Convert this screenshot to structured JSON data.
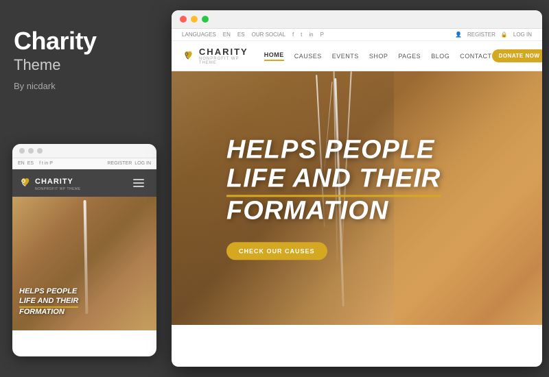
{
  "theme": {
    "title": "Charity",
    "subtitle": "Theme",
    "author": "By nicdark"
  },
  "mobile": {
    "lang_items": [
      "EN",
      "ES"
    ],
    "register": "REGISTER",
    "login": "LOG IN",
    "logo_name": "CHARITY",
    "logo_tagline": "NONPROFIT WP THEME",
    "hero_line1": "HELPS PEOPLE",
    "hero_line2": "LIFE AND THEIR",
    "hero_line3": "FORMATION"
  },
  "desktop": {
    "top_bar": {
      "languages": "LANGUAGES",
      "lang_en": "EN",
      "lang_es": "ES",
      "our_social": "OUR SOCIAL",
      "register": "REGISTER",
      "login": "LOG IN"
    },
    "nav": {
      "logo_name": "CHARITY",
      "logo_tagline": "NONPROFIT WP THEME",
      "menu_items": [
        "HOME",
        "CAUSES",
        "EVENTS",
        "SHOP",
        "PAGES",
        "BLOG",
        "CONTACT"
      ],
      "donate_label": "DONATE NOW"
    },
    "hero": {
      "line1": "HELPS PEOPLE",
      "line2": "LIFE AND THEIR",
      "line3": "FORMATION",
      "cta": "CHECK OUR CAUSES"
    }
  },
  "colors": {
    "accent": "#d4a820",
    "dark_bg": "#3a3a3a",
    "nav_dark": "#444444",
    "white": "#ffffff"
  }
}
